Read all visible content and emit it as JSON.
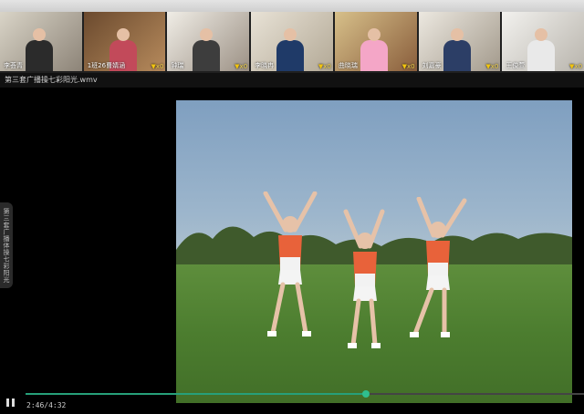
{
  "participants": [
    {
      "name": "李荟青",
      "score": ""
    },
    {
      "name": "1班26曹婧涵",
      "score": "x0"
    },
    {
      "name": "钟瑞",
      "score": "x0"
    },
    {
      "name": "李晓冉",
      "score": "x0"
    },
    {
      "name": "曲晓瑞",
      "score": "x0"
    },
    {
      "name": "刘嘉豪",
      "score": "x0"
    },
    {
      "name": "王俊萱",
      "score": "x0"
    }
  ],
  "file": {
    "name": "第三套广播操七彩阳光.wmv"
  },
  "side_tab": {
    "label": "第三套广播体操七彩阳光"
  },
  "player": {
    "time": "2:46/4:32",
    "progress": 0.61
  },
  "colors": {
    "accent": "#27a07a",
    "shirt": "#e8623a"
  }
}
